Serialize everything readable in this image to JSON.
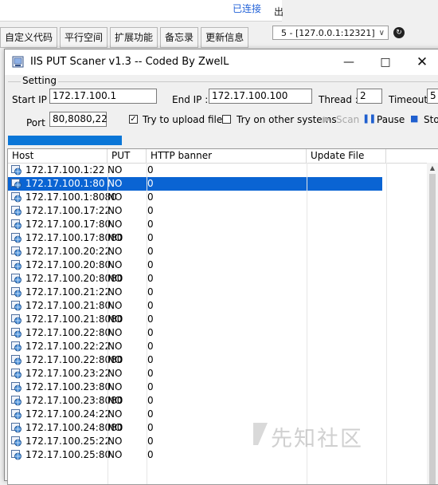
{
  "background": {
    "status": "已连接",
    "menu_tail": "出",
    "tabs": [
      "自定义代码",
      "平行空间",
      "扩展功能",
      "备忘录",
      "更新信息"
    ],
    "server_select": "5 - [127.0.0.1:12321]"
  },
  "window": {
    "title": "IIS PUT Scaner v1.3 -- Coded By ZwelL",
    "min": "—",
    "max": "□",
    "close": "✕"
  },
  "setting": {
    "legend": "Setting",
    "start_ip_label": "Start IP :",
    "start_ip": "172.17.100.1",
    "end_ip_label": "End IP :",
    "end_ip": "172.17.100.100",
    "thread_label": "Thread :",
    "thread": "2",
    "timeout_label": "Timeout :",
    "timeout": "5",
    "port_label": "Port :",
    "port": "80,8080,22",
    "upload_label": "Try to upload file",
    "upload_checked": true,
    "other_systems_label": "Try on other systems",
    "other_systems_checked": false,
    "scan_label": "Scan",
    "pause_label": "Pause",
    "stop_label": "Stop"
  },
  "results": {
    "columns": [
      "Host",
      "PUT",
      "HTTP banner",
      "Update File"
    ],
    "rows": [
      {
        "host": "172.17.100.1:22",
        "put": "NO",
        "banner": "0"
      },
      {
        "host": "172.17.100.1:80",
        "put": "NO",
        "banner": "0",
        "selected": true
      },
      {
        "host": "172.17.100.1:8080",
        "put": "NO",
        "banner": "0"
      },
      {
        "host": "172.17.100.17:22",
        "put": "NO",
        "banner": "0"
      },
      {
        "host": "172.17.100.17:80",
        "put": "NO",
        "banner": "0"
      },
      {
        "host": "172.17.100.17:8080",
        "put": "NO",
        "banner": "0"
      },
      {
        "host": "172.17.100.20:22",
        "put": "NO",
        "banner": "0"
      },
      {
        "host": "172.17.100.20:80",
        "put": "NO",
        "banner": "0"
      },
      {
        "host": "172.17.100.20:8080",
        "put": "NO",
        "banner": "0"
      },
      {
        "host": "172.17.100.21:22",
        "put": "NO",
        "banner": "0"
      },
      {
        "host": "172.17.100.21:80",
        "put": "NO",
        "banner": "0"
      },
      {
        "host": "172.17.100.21:8080",
        "put": "NO",
        "banner": "0"
      },
      {
        "host": "172.17.100.22:80",
        "put": "NO",
        "banner": "0"
      },
      {
        "host": "172.17.100.22:22",
        "put": "NO",
        "banner": "0"
      },
      {
        "host": "172.17.100.22:8080",
        "put": "NO",
        "banner": "0"
      },
      {
        "host": "172.17.100.23:22",
        "put": "NO",
        "banner": "0"
      },
      {
        "host": "172.17.100.23:80",
        "put": "NO",
        "banner": "0"
      },
      {
        "host": "172.17.100.23:8080",
        "put": "NO",
        "banner": "0"
      },
      {
        "host": "172.17.100.24:22",
        "put": "NO",
        "banner": "0"
      },
      {
        "host": "172.17.100.24:8080",
        "put": "NO",
        "banner": "0"
      },
      {
        "host": "172.17.100.25:22",
        "put": "NO",
        "banner": "0"
      },
      {
        "host": "172.17.100.25:80",
        "put": "NO",
        "banner": "0"
      }
    ]
  },
  "watermark": "先知社区",
  "colors": {
    "selection": "#0a64d3",
    "progress": "#0a76d7",
    "link": "#2463d8"
  }
}
